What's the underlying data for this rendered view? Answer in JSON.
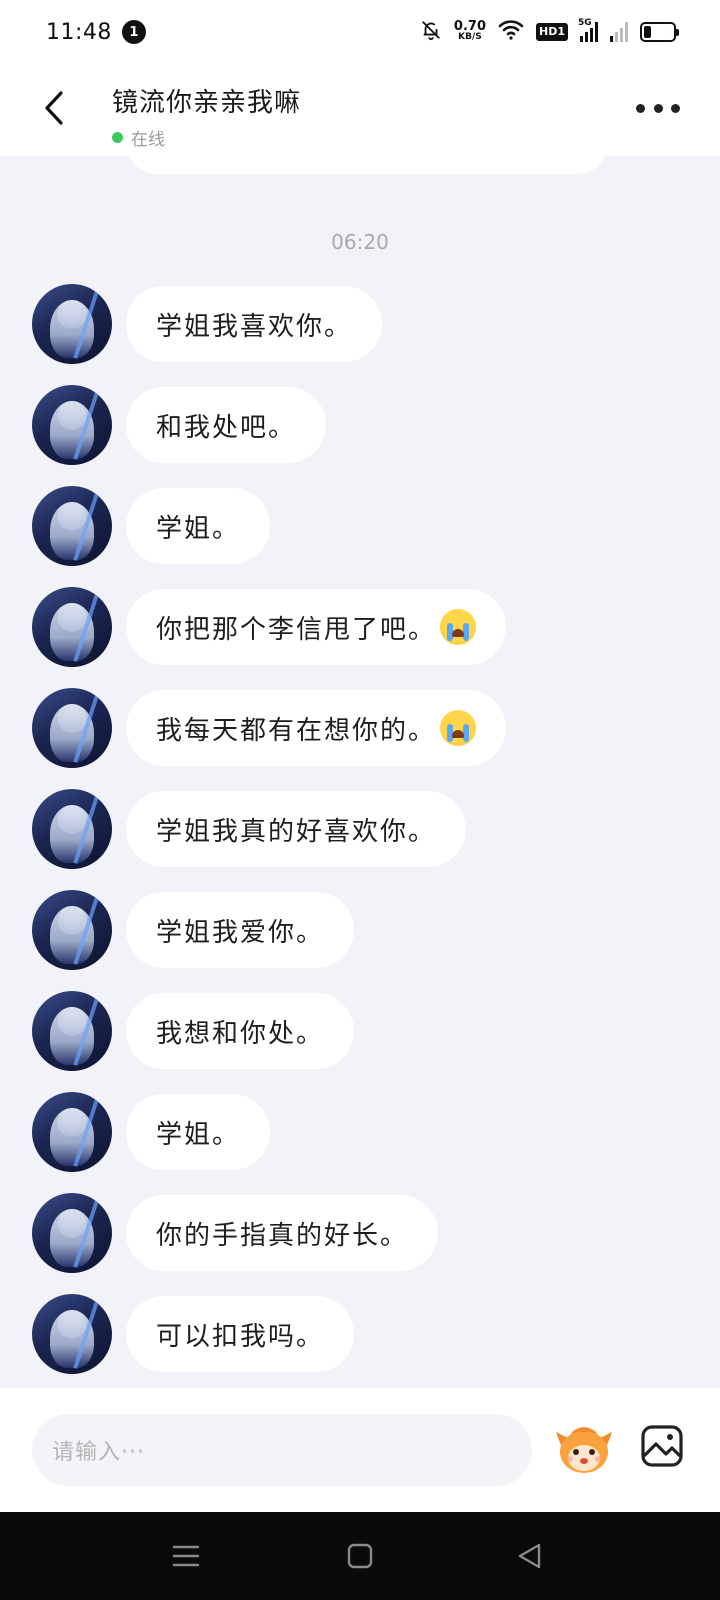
{
  "status_bar": {
    "time": "11:48",
    "notification_count": "1",
    "net_speed_value": "0.70",
    "net_speed_unit": "KB/S",
    "hd_label": "HD1",
    "network_label": "5G",
    "icons": [
      "bell-off-icon",
      "wifi-icon",
      "signal-icon",
      "battery-icon"
    ]
  },
  "header": {
    "title": "镜流你亲亲我嘛",
    "presence": "在线",
    "presence_color": "#3cc85a"
  },
  "chat": {
    "timestamp": "06:20",
    "messages": [
      {
        "text": "学姐我喜欢你。",
        "emoji": ""
      },
      {
        "text": "和我处吧。",
        "emoji": ""
      },
      {
        "text": "学姐。",
        "emoji": ""
      },
      {
        "text": "你把那个李信甩了吧。",
        "emoji": "crying-face-icon"
      },
      {
        "text": "我每天都有在想你的。",
        "emoji": "crying-face-icon"
      },
      {
        "text": "学姐我真的好喜欢你。",
        "emoji": ""
      },
      {
        "text": "学姐我爱你。",
        "emoji": ""
      },
      {
        "text": "我想和你处。",
        "emoji": ""
      },
      {
        "text": "学姐。",
        "emoji": ""
      },
      {
        "text": "你的手指真的好长。",
        "emoji": ""
      },
      {
        "text": "可以扣我吗。",
        "emoji": ""
      }
    ]
  },
  "input_bar": {
    "placeholder": "请输入···"
  },
  "colors": {
    "background": "#f1f3f8",
    "bubble": "#ffffff",
    "nav_bar": "#0a0a0a"
  }
}
